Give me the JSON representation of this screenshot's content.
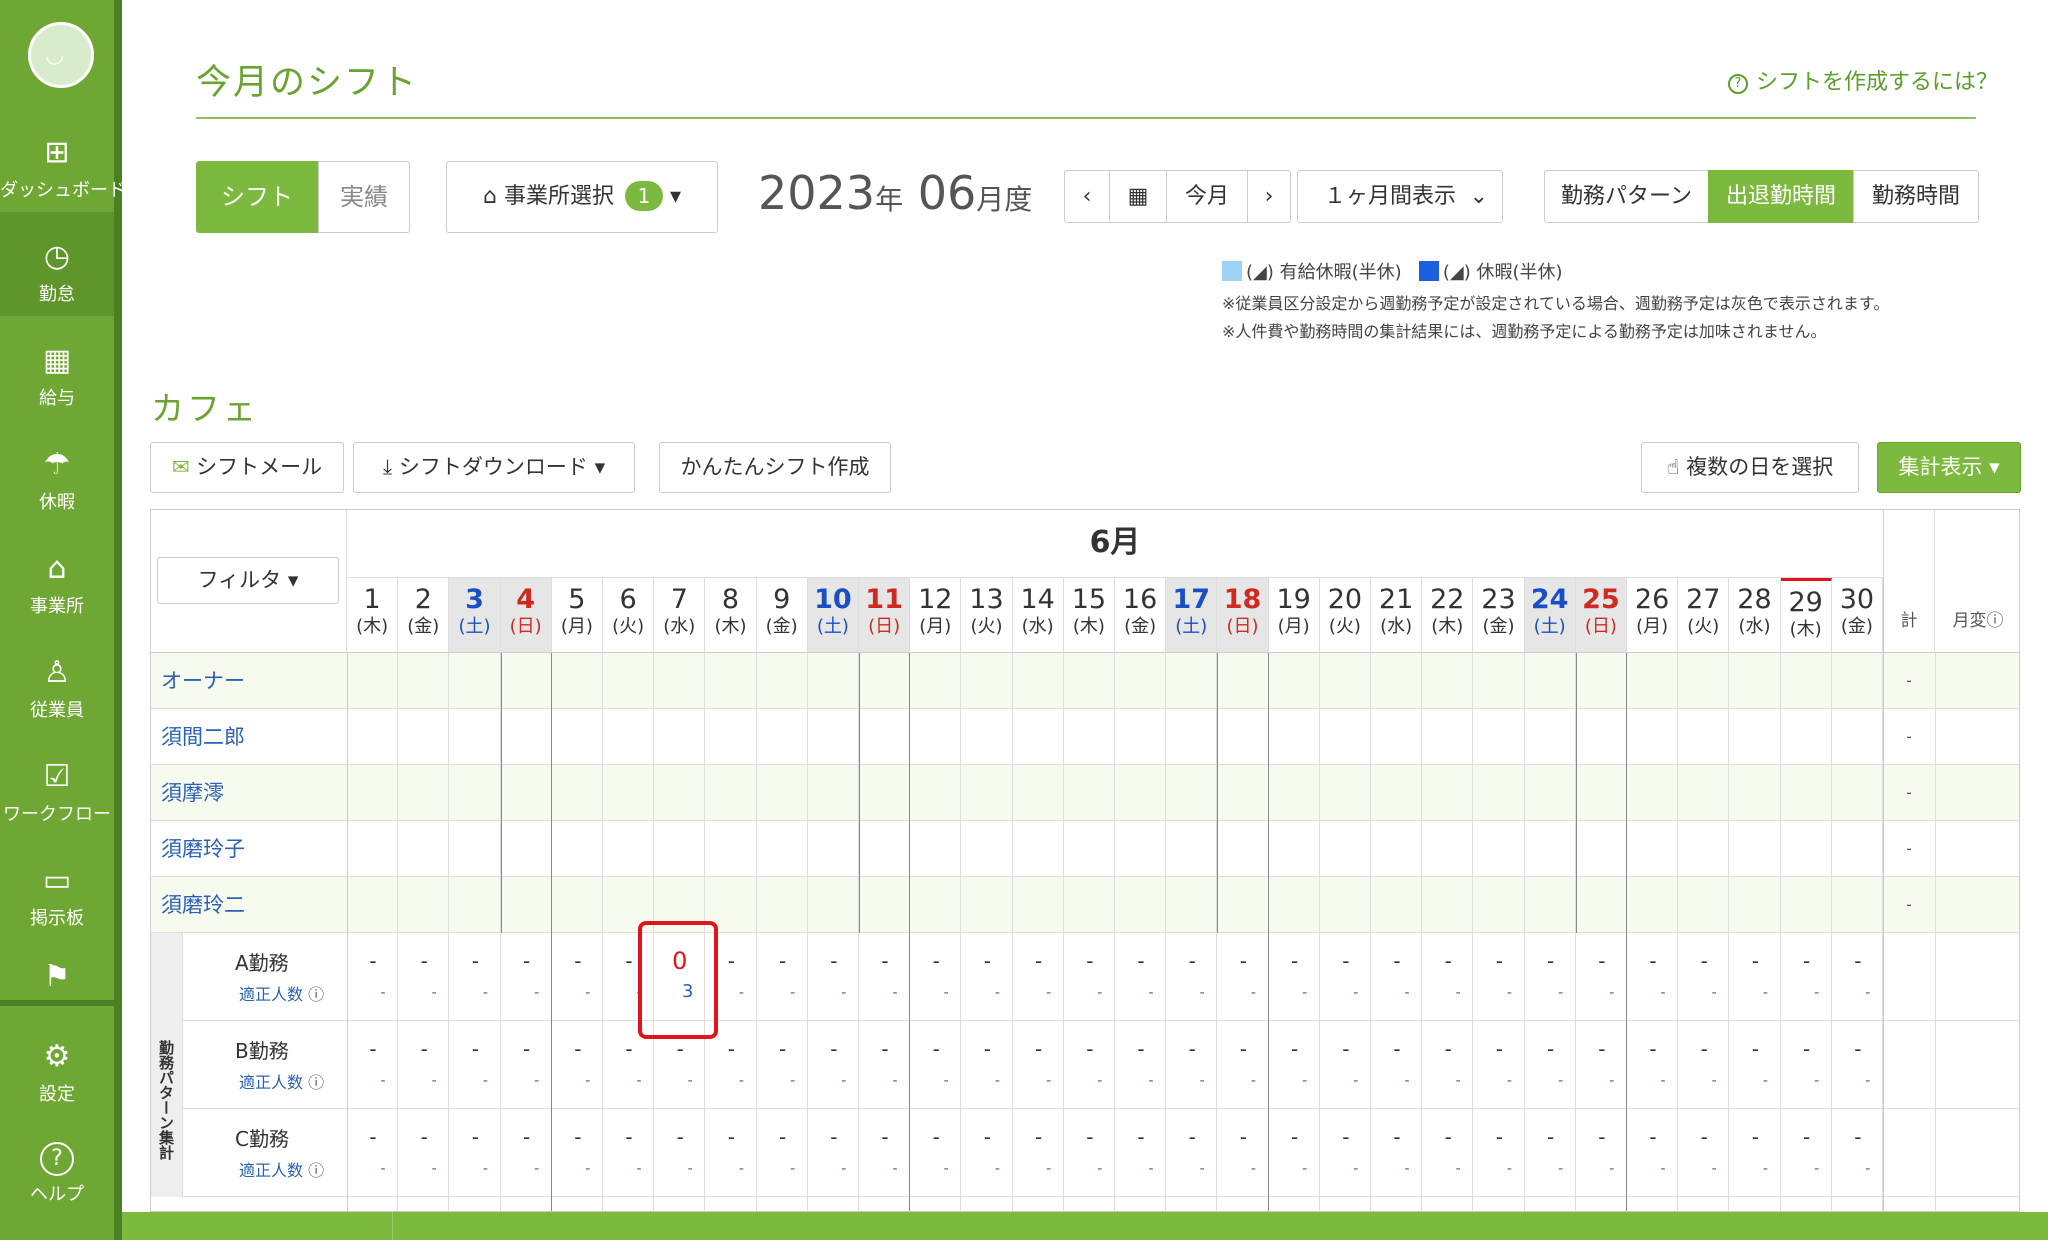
{
  "sidebar": {
    "items": [
      {
        "label": "ダッシュボード",
        "icon": "dashboard-icon"
      },
      {
        "label": "勤怠",
        "icon": "clock-icon"
      },
      {
        "label": "給与",
        "icon": "calculator-icon"
      },
      {
        "label": "休暇",
        "icon": "umbrella-icon"
      },
      {
        "label": "事業所",
        "icon": "home-icon"
      },
      {
        "label": "従業員",
        "icon": "person-icon"
      },
      {
        "label": "ワークフロー",
        "icon": "checklist-icon"
      },
      {
        "label": "掲示板",
        "icon": "chat-icon"
      },
      {
        "label": "",
        "icon": "flag-icon"
      },
      {
        "label": "設定",
        "icon": "gear-icon"
      },
      {
        "label": "ヘルプ",
        "icon": "help-icon"
      }
    ],
    "active_index": 1
  },
  "header": {
    "title": "今月のシフト",
    "help_link": "シフトを作成するには？"
  },
  "toolbar": {
    "tab_shift": "シフト",
    "tab_actual": "実績",
    "office_select": "事業所選択",
    "office_badge": "1",
    "year": "2023",
    "year_unit": "年",
    "month": "06",
    "month_unit": "月度",
    "prev": "‹",
    "calendar_icon": "calendar-icon",
    "today": "今月",
    "next": "›",
    "range_select": "１ヶ月間表示",
    "view_pattern": "勤務パターン",
    "view_inout": "出退勤時間",
    "view_hours": "勤務時間"
  },
  "legend": {
    "paid_leave": "有給休暇(半休)",
    "leave": "休暇(半休)",
    "paid_color": "#9fd3f5",
    "leave_color": "#1a5fe0",
    "note1": "※従業員区分設定から週勤務予定が設定されている場合、週勤務予定は灰色で表示されます。",
    "note2": "※人件費や勤務時間の集計結果には、週勤務予定による勤務予定は加味されません。"
  },
  "section": {
    "title": "カフェ",
    "shift_mail": "シフトメール",
    "shift_download": "シフトダウンロード",
    "easy_shift": "かんたんシフト作成",
    "multi_select": "複数の日を選択",
    "summary": "集計表示"
  },
  "table": {
    "month_label": "6月",
    "filter": "フィルタ",
    "total_label": "計",
    "monthly_change": "月変",
    "days": [
      {
        "d": "1",
        "w": "(木)",
        "t": "n"
      },
      {
        "d": "2",
        "w": "(金)",
        "t": "n"
      },
      {
        "d": "3",
        "w": "(土)",
        "t": "sat"
      },
      {
        "d": "4",
        "w": "(日)",
        "t": "sun"
      },
      {
        "d": "5",
        "w": "(月)",
        "t": "n"
      },
      {
        "d": "6",
        "w": "(火)",
        "t": "n"
      },
      {
        "d": "7",
        "w": "(水)",
        "t": "n"
      },
      {
        "d": "8",
        "w": "(木)",
        "t": "n"
      },
      {
        "d": "9",
        "w": "(金)",
        "t": "n"
      },
      {
        "d": "10",
        "w": "(土)",
        "t": "sat"
      },
      {
        "d": "11",
        "w": "(日)",
        "t": "sun"
      },
      {
        "d": "12",
        "w": "(月)",
        "t": "n"
      },
      {
        "d": "13",
        "w": "(火)",
        "t": "n"
      },
      {
        "d": "14",
        "w": "(水)",
        "t": "n"
      },
      {
        "d": "15",
        "w": "(木)",
        "t": "n"
      },
      {
        "d": "16",
        "w": "(金)",
        "t": "n"
      },
      {
        "d": "17",
        "w": "(土)",
        "t": "sat"
      },
      {
        "d": "18",
        "w": "(日)",
        "t": "sun"
      },
      {
        "d": "19",
        "w": "(月)",
        "t": "n"
      },
      {
        "d": "20",
        "w": "(火)",
        "t": "n"
      },
      {
        "d": "21",
        "w": "(水)",
        "t": "n"
      },
      {
        "d": "22",
        "w": "(木)",
        "t": "n"
      },
      {
        "d": "23",
        "w": "(金)",
        "t": "n"
      },
      {
        "d": "24",
        "w": "(土)",
        "t": "sat"
      },
      {
        "d": "25",
        "w": "(日)",
        "t": "sun"
      },
      {
        "d": "26",
        "w": "(月)",
        "t": "n"
      },
      {
        "d": "27",
        "w": "(火)",
        "t": "n"
      },
      {
        "d": "28",
        "w": "(水)",
        "t": "n"
      },
      {
        "d": "29",
        "w": "(木)",
        "t": "today"
      },
      {
        "d": "30",
        "w": "(金)",
        "t": "n"
      }
    ],
    "employees": [
      "オーナー",
      "須間二郎",
      "須摩澪",
      "須磨玲子",
      "須磨玲二"
    ],
    "employee_total": "-",
    "pattern_group_label": "勤務パターン集計",
    "patterns": [
      {
        "name": "A勤務",
        "sub": "適正人数",
        "highlight_day_index": 6,
        "highlight_top": "0",
        "highlight_bottom": "3"
      },
      {
        "name": "B勤務",
        "sub": "適正人数"
      },
      {
        "name": "C勤務",
        "sub": "適正人数"
      }
    ],
    "empty_value": "-"
  },
  "colors": {
    "brand_green": "#7db93f",
    "sat_blue": "#1a4fc4",
    "sun_red": "#d0291f",
    "highlight_red": "#e0141b"
  }
}
